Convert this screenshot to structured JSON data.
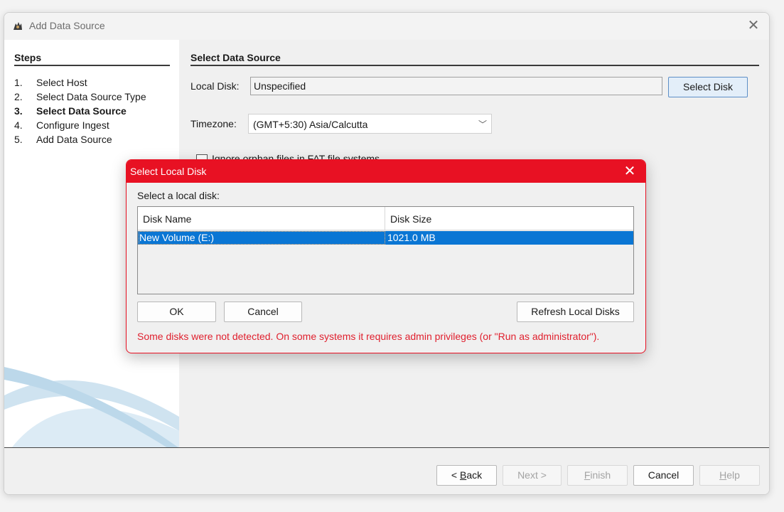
{
  "window": {
    "title": "Add Data Source",
    "icon": "app-logo-icon",
    "close_icon": "close-icon"
  },
  "steps": {
    "title": "Steps",
    "items": [
      {
        "num": "1.",
        "label": "Select Host"
      },
      {
        "num": "2.",
        "label": "Select Data Source Type"
      },
      {
        "num": "3.",
        "label": "Select Data Source",
        "current": true
      },
      {
        "num": "4.",
        "label": "Configure Ingest"
      },
      {
        "num": "5.",
        "label": "Add Data Source"
      }
    ]
  },
  "main": {
    "title": "Select Data Source",
    "local_disk_label": "Local Disk:",
    "local_disk_value": "Unspecified",
    "select_disk_button": "Select Disk",
    "timezone_label": "Timezone:",
    "timezone_value": "(GMT+5:30) Asia/Calcutta",
    "checkbox_label": "Ignore orphan files in FAT file systems"
  },
  "footer": {
    "back": {
      "prefix": "< ",
      "mnemonic": "B",
      "rest": "ack"
    },
    "next": "Next >",
    "finish": {
      "mnemonic": "F",
      "rest": "inish"
    },
    "cancel": "Cancel",
    "help": {
      "mnemonic": "H",
      "rest": "elp"
    }
  },
  "dialog": {
    "title": "Select Local Disk",
    "prompt": "Select a local disk:",
    "columns": [
      "Disk Name",
      "Disk Size"
    ],
    "rows": [
      {
        "name": "New Volume (E:)",
        "size": "1021.0 MB"
      }
    ],
    "ok": "OK",
    "cancel": "Cancel",
    "refresh": "Refresh Local Disks",
    "warning": "Some disks were not detected. On some systems it requires admin privileges (or \"Run as administrator\")."
  },
  "colors": {
    "dialog_accent": "#e81123",
    "selection": "#0a76d4",
    "warning_text": "#e0202e"
  }
}
